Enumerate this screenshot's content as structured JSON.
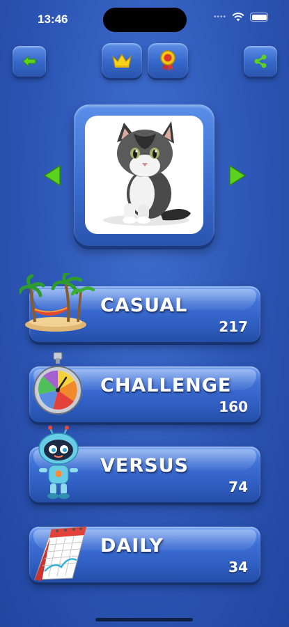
{
  "status": {
    "time": "13:46",
    "dots": "••••"
  },
  "colors": {
    "accent_green": "#5bd21e",
    "crown_yellow": "#f7d21a",
    "medal_red": "#e0372c",
    "button_blue": "#3566c8"
  },
  "top_bar": {
    "back_icon": "back-arrow-icon",
    "crown_icon": "crown-icon",
    "medal_icon": "medal-icon",
    "share_icon": "share-icon"
  },
  "picture": {
    "subject": "kitten-image",
    "prev_icon": "triangle-left-icon",
    "next_icon": "triangle-right-icon"
  },
  "modes": [
    {
      "label": "CASUAL",
      "count": "217",
      "icon": "palm-island-icon"
    },
    {
      "label": "CHALLENGE",
      "count": "160",
      "icon": "stopwatch-icon"
    },
    {
      "label": "VERSUS",
      "count": "74",
      "icon": "robot-icon"
    },
    {
      "label": "DAILY",
      "count": "34",
      "icon": "calendar-icon"
    }
  ]
}
